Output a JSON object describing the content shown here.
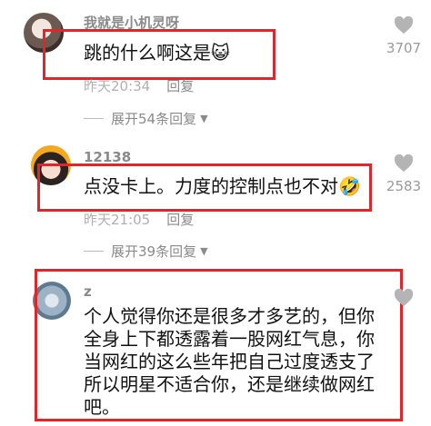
{
  "comments": [
    {
      "username": "我就是小机灵呀",
      "text": "跳的什么啊这是",
      "emoji": "😺",
      "time": "昨天20:34",
      "reply_label": "回复",
      "expand_label": "展开54条回复",
      "likes": "3707"
    },
    {
      "username": "12138",
      "text": "点没卡上。力度的控制点也不对",
      "emoji": "🤣",
      "time": "昨天21:05",
      "reply_label": "回复",
      "expand_label": "展开39条回复",
      "likes": "2583"
    },
    {
      "username": "z",
      "text_lines": [
        "个人觉得你还是很多才多艺的，但你",
        "全身上下都透露着一股网红气息，你",
        "当网红的这么些年把自己过度透支了",
        "所以明星不适合你，还是继续做网红",
        "吧。"
      ],
      "likes": ""
    }
  ],
  "icons": {
    "like": "heart-like-icon",
    "expand": "chevron-down-icon"
  },
  "colors": {
    "highlight_border": "#e0262b",
    "meta_text": "#b0b0b0",
    "username_text": "#8a8a8a"
  }
}
